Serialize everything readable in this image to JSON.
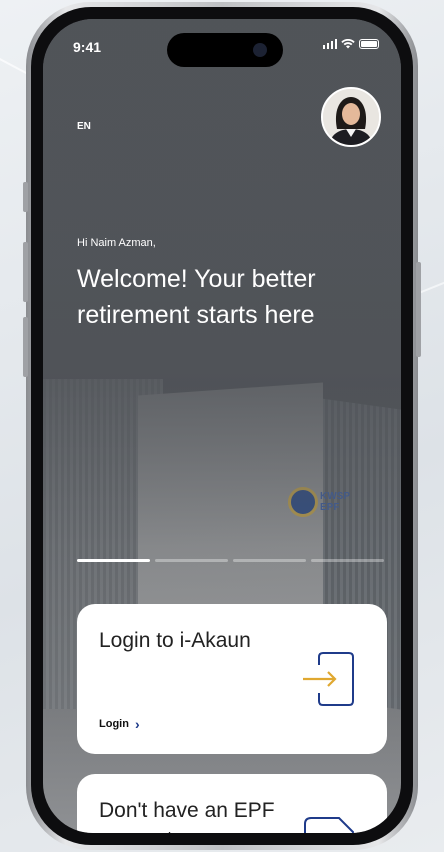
{
  "status": {
    "time": "9:41"
  },
  "header": {
    "language": "EN"
  },
  "hero": {
    "greeting": "Hi Naim Azman,",
    "headline": "Welcome! Your better retirement starts here"
  },
  "pager": {
    "pages": 4,
    "active_index": 0
  },
  "cards": {
    "login": {
      "title": "Login to i-Akaun",
      "link_label": "Login"
    },
    "register": {
      "title": "Don't have an EPF account"
    }
  },
  "colors": {
    "accent_blue": "#1f3b8a",
    "accent_gold": "#e0a830"
  }
}
